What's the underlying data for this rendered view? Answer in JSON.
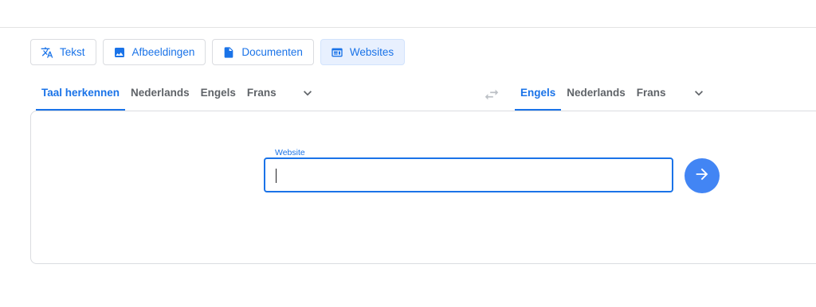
{
  "modes": [
    {
      "label": "Tekst",
      "icon": "translate-icon",
      "active": false
    },
    {
      "label": "Afbeeldingen",
      "icon": "image-icon",
      "active": false
    },
    {
      "label": "Documenten",
      "icon": "document-icon",
      "active": false
    },
    {
      "label": "Websites",
      "icon": "website-icon",
      "active": true
    }
  ],
  "source_languages": [
    "Taal herkennen",
    "Nederlands",
    "Engels",
    "Frans"
  ],
  "target_languages": [
    "Engels",
    "Nederlands",
    "Frans"
  ],
  "website": {
    "label": "Website",
    "value": ""
  },
  "colors": {
    "accent": "#1a73e8",
    "button": "#4285f4",
    "active_bg": "#e8f0fe",
    "border": "#dadce0"
  }
}
